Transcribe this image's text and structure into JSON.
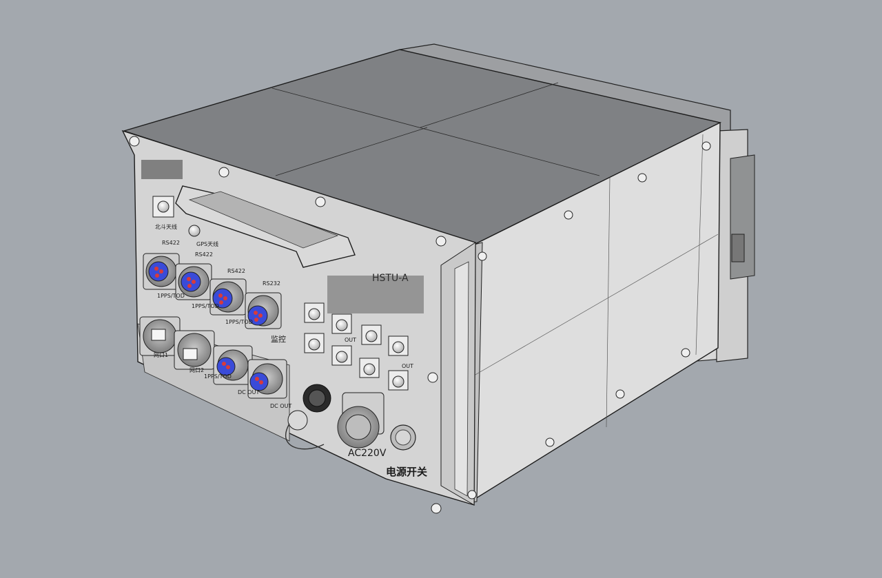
{
  "labels": {
    "antenna_1": "北斗天线",
    "antenna_2": "GPS天线",
    "rs422_1": "RS422",
    "rs422_2": "RS422",
    "rs422_3": "RS422",
    "rs232": "RS232",
    "pps_tod_1": "1PPS/TOD",
    "pps_tod_2": "1PPS/TOD",
    "pps_tod_3": "1PPS/TOD",
    "monitor": "监控",
    "network_1": "网口1",
    "network_2": "网口2",
    "network_3": "1PPS/TOD",
    "dc_out_1": "DC OUT",
    "dc_out_2": "DC OUT",
    "model": "HSTU-A",
    "out_label": "OUT",
    "ac_input": "AC220V",
    "power_switch": "电源开关"
  },
  "colors": {
    "background": "#a3a8ae",
    "panel_front": "#d6d6d6",
    "panel_top": "#7d7f82",
    "panel_side": "#dcdcdc",
    "connector_pin": "#3a4bd8",
    "pin_red": "#d83a3a"
  }
}
